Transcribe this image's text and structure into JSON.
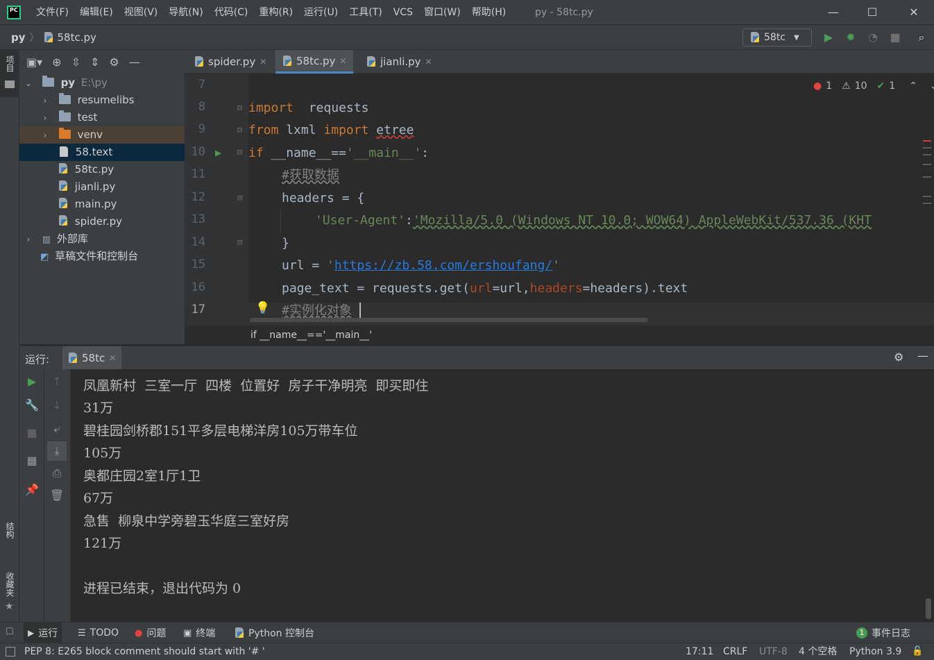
{
  "menu": [
    "文件(F)",
    "编辑(E)",
    "视图(V)",
    "导航(N)",
    "代码(C)",
    "重构(R)",
    "运行(U)",
    "工具(T)",
    "VCS",
    "窗口(W)",
    "帮助(H)"
  ],
  "window_title": "py - 58tc.py",
  "app_logo": "PC",
  "breadcrumb": {
    "root": "py",
    "file": "58tc.py"
  },
  "run_config": "58tc",
  "left_strip": {
    "project": "项目",
    "structure": "结构",
    "favorites": "收藏夹"
  },
  "project_tree": {
    "root_name": "py",
    "root_path": "E:\\py",
    "items": [
      "resumelibs",
      "test",
      "venv",
      "58.text",
      "58tc.py",
      "jianli.py",
      "main.py",
      "spider.py"
    ],
    "external": "外部库",
    "scratches": "草稿文件和控制台"
  },
  "tabs": [
    "spider.py",
    "58tc.py",
    "jianli.py"
  ],
  "line_numbers": [
    "7",
    "8",
    "9",
    "10",
    "11",
    "12",
    "13",
    "14",
    "15",
    "16",
    "17"
  ],
  "code": {
    "l8_kw": "import",
    "l8_rest": "requests",
    "l9_from": "from",
    "l9_mod": "lxml",
    "l9_import": "import",
    "l9_name": "etree",
    "l10_if": "if",
    "l10_cond": "__name__==",
    "l10_str": "'__main__'",
    "l10_colon": ":",
    "l11_comment": "#获取数据",
    "l12_code": "headers = {",
    "l13_key": "'User-Agent'",
    "l13_colon": ":",
    "l13_val": "'Mozilla/5.0 (Windows NT 10.0; WOW64) AppleWebKit/537.36 (KHT",
    "l14_code": "}",
    "l15_code": "url = ",
    "l15_quote_open": "'",
    "l15_url": "https://zb.58.com/ershoufang/",
    "l15_quote_close": "'",
    "l16_a": "page_text = requests.get(",
    "l16_p1": "url",
    "l16_b": "=url,",
    "l16_p2": "headers",
    "l16_c": "=headers).text",
    "l17_comment": "#实例化对象"
  },
  "inspections": {
    "errors": "1",
    "warnings": "10",
    "weak": "1"
  },
  "editor_breadcrumb": "if __name__=='__main__'",
  "run_panel": {
    "label": "运行:",
    "tab": "58tc"
  },
  "console_lines": [
    "凤凰新村  三室一厅  四楼  位置好  房子干净明亮  即买即住",
    "31万",
    "碧桂园剑桥郡151平多层电梯洋房105万带车位",
    "105万",
    "奥都庄园2室1厅1卫",
    "67万",
    "急售  柳泉中学旁碧玉华庭三室好房",
    "121万",
    "",
    "进程已结束，退出代码为 0"
  ],
  "tool_windows": {
    "run": "运行",
    "todo": "TODO",
    "problems": "问题",
    "terminal": "终端",
    "python_console": "Python 控制台",
    "event_log": "事件日志",
    "event_count": "1"
  },
  "status": {
    "message": "PEP 8: E265 block comment should start with '# '",
    "position": "17:11",
    "line_sep": "CRLF",
    "encoding": "UTF-8",
    "indent": "4 个空格",
    "interpreter": "Python 3.9"
  },
  "colors": {
    "keyword": "#cc7832",
    "string": "#6a8759",
    "comment": "#808080",
    "param": "#aa4926",
    "accent": "#4a88c7",
    "run_green": "#499c54"
  }
}
